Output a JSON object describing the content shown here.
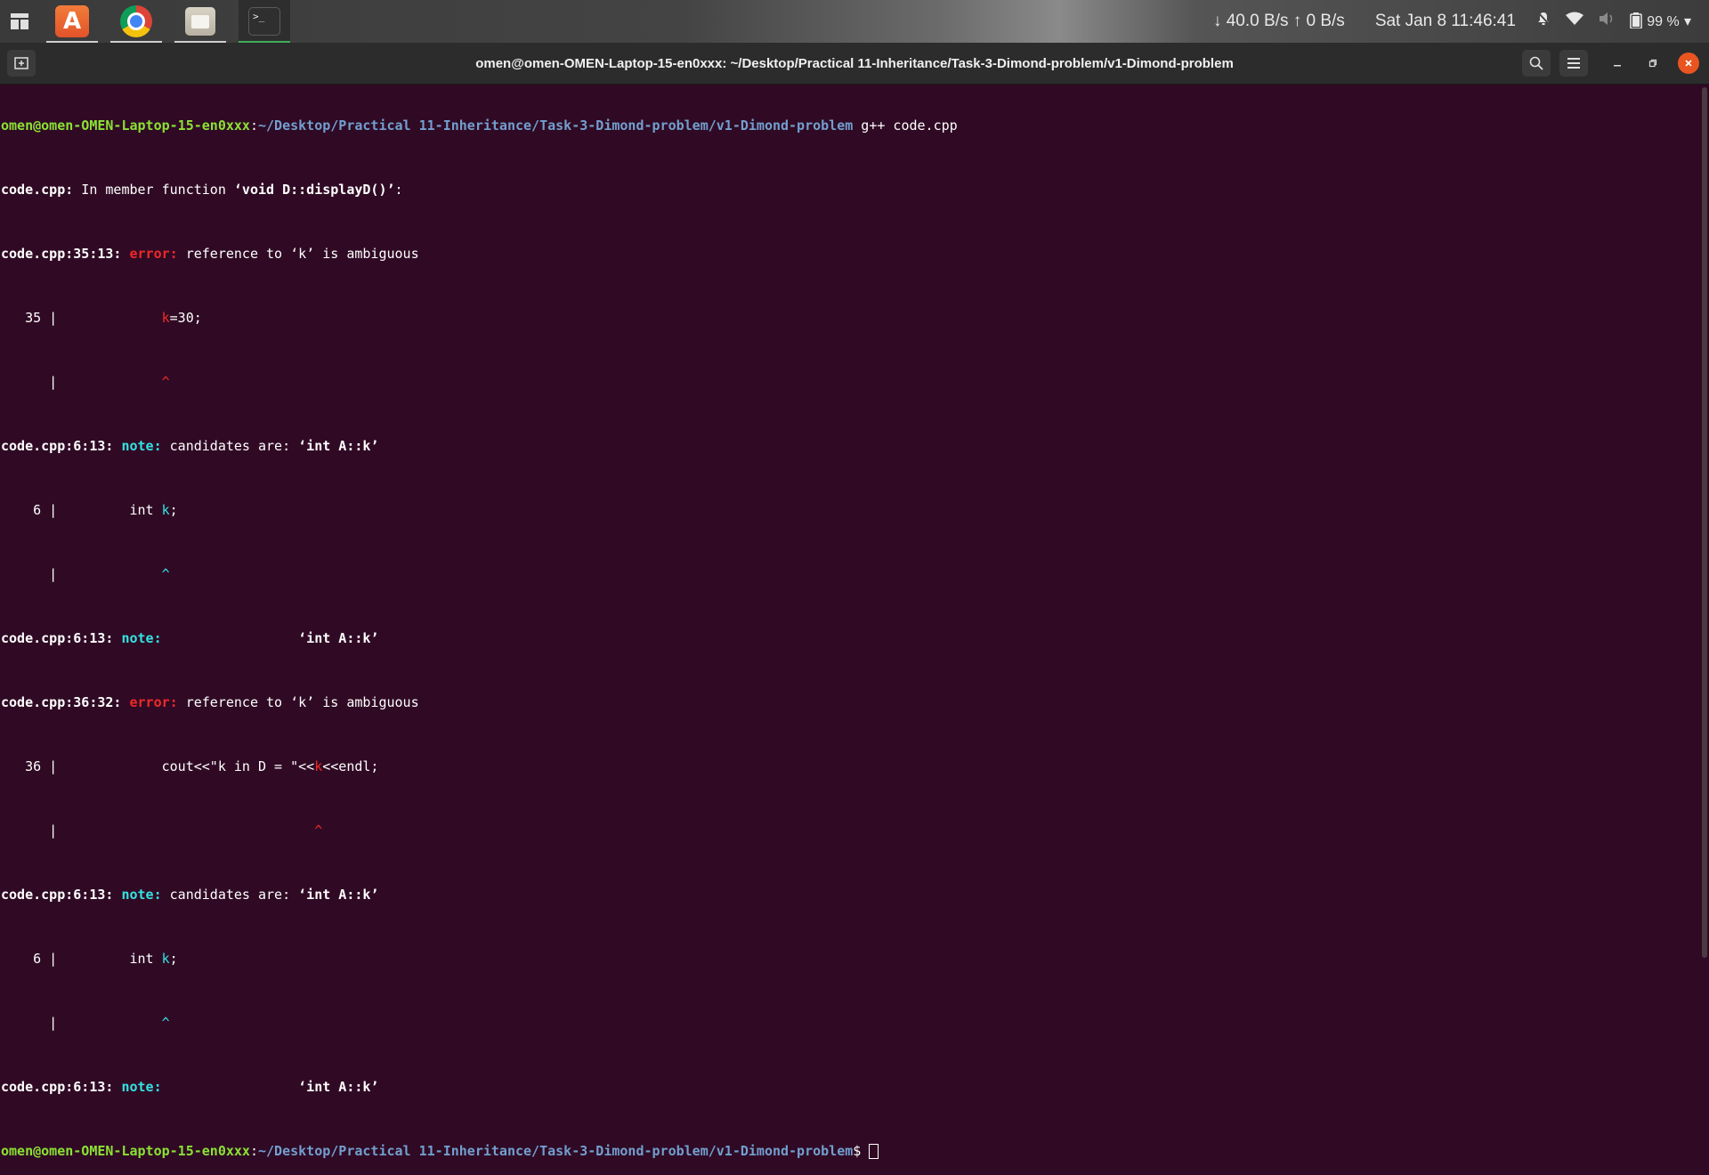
{
  "topbar": {
    "apps": [
      {
        "name": "app-grid",
        "icon": "app-grid-icon"
      },
      {
        "name": "ubuntu-software",
        "icon": "software-store-icon",
        "glyph": "A"
      },
      {
        "name": "chrome",
        "icon": "chrome-icon"
      },
      {
        "name": "files",
        "icon": "files-icon"
      },
      {
        "name": "terminal",
        "icon": "terminal-icon",
        "glyph": ">_"
      }
    ],
    "net_down": "↓ 40.0 B/s",
    "net_up": "↑ 0 B/s",
    "date": "Sat Jan 8",
    "time": "11:46:41",
    "battery": "99 %"
  },
  "window": {
    "title": "omen@omen-OMEN-Laptop-15-en0xxx: ~/Desktop/Practical 11-Inheritance/Task-3-Dimond-problem/v1-Dimond-problem",
    "colors": {
      "background": "#300a24",
      "prompt_user": "#8ae234",
      "prompt_path": "#729fcf",
      "error": "#ef2929",
      "note": "#34e2e2"
    }
  },
  "terminal": {
    "prompt_user": "omen@omen-OMEN-Laptop-15-en0xxx",
    "prompt_path": "~/Desktop/Practical 11-Inheritance/Task-3-Dimond-problem/v1-Dimond-problem",
    "command": " g++ code.cpp",
    "l2_loc": "code.cpp:",
    "l2_text": " In member function ",
    "l2_func": "‘void D::displayD()’",
    "l2_colon": ":",
    "l3_loc": "code.cpp:35:13:",
    "l3_tag": " error:",
    "l3_text": " reference to ‘k’ is ambiguous",
    "l4_pre": "   35 |             ",
    "l4_hl": "k",
    "l4_post": "=30;",
    "l5_pre": "      |             ",
    "l5_caret": "^",
    "l6_loc": "code.cpp:6:13:",
    "l6_tag": " note:",
    "l6_text": " candidates are: ",
    "l6_cand": "‘int A::k’",
    "l7_pre": "    6 |         int ",
    "l7_hl": "k",
    "l7_post": ";",
    "l8_pre": "      |             ",
    "l8_caret": "^",
    "l9_loc": "code.cpp:6:13:",
    "l9_tag": " note:",
    "l9_pad": "                 ",
    "l9_cand": "‘int A::k’",
    "l10_loc": "code.cpp:36:32:",
    "l10_tag": " error:",
    "l10_text": " reference to ‘k’ is ambiguous",
    "l11_pre": "   36 |             cout<<\"k in D = \"<<",
    "l11_hl": "k",
    "l11_post": "<<endl;",
    "l12_pre": "      |                                ",
    "l12_caret": "^",
    "l13_loc": "code.cpp:6:13:",
    "l13_tag": " note:",
    "l13_text": " candidates are: ",
    "l13_cand": "‘int A::k’",
    "l14_pre": "    6 |         int ",
    "l14_hl": "k",
    "l14_post": ";",
    "l15_pre": "      |             ",
    "l15_caret": "^",
    "l16_loc": "code.cpp:6:13:",
    "l16_tag": " note:",
    "l16_pad": "                 ",
    "l16_cand": "‘int A::k’",
    "final_dollar": "$ "
  }
}
